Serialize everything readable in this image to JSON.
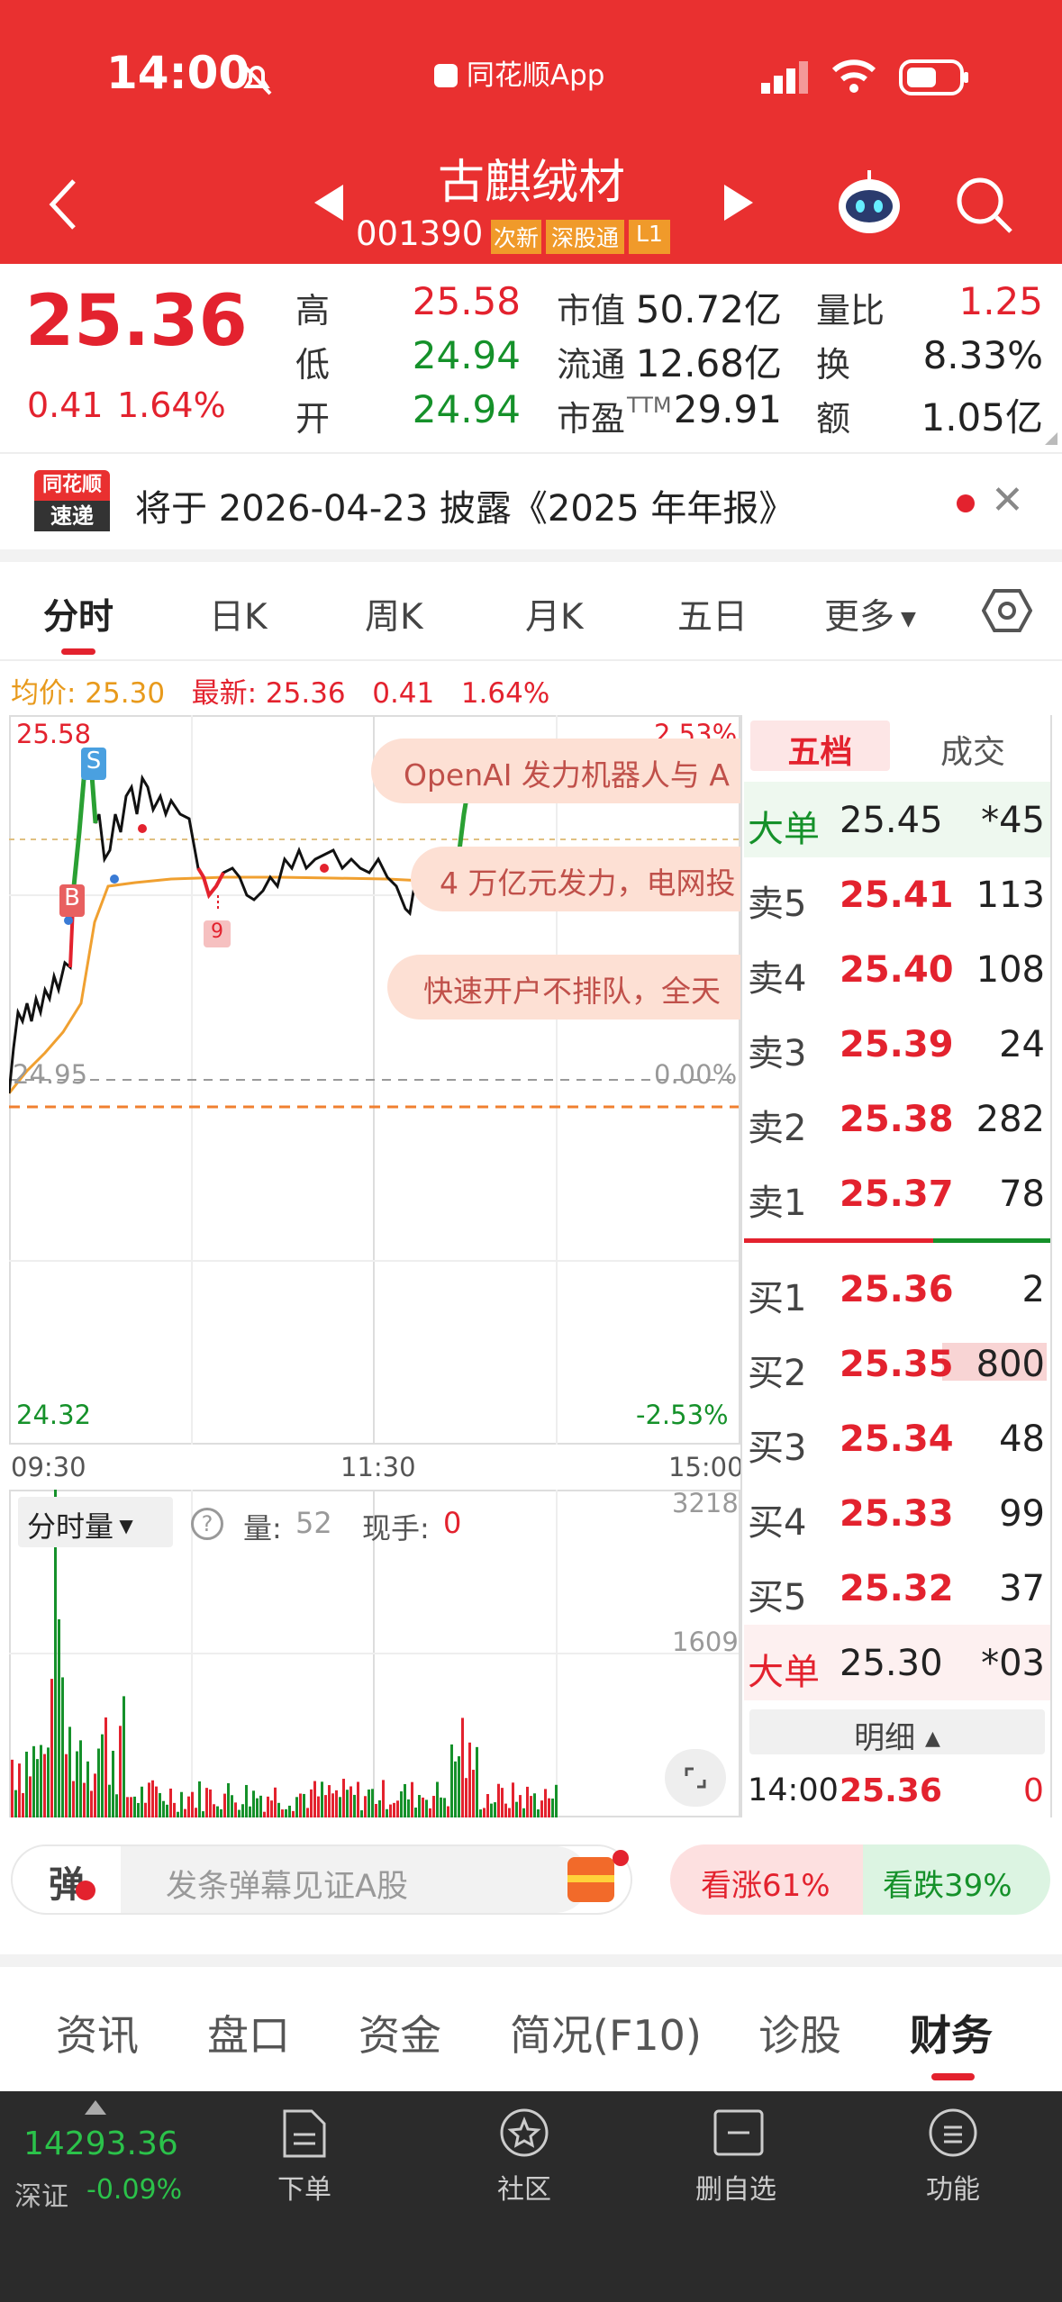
{
  "status": {
    "time": "14:00",
    "center": "同花顺App"
  },
  "header": {
    "name": "古麒绒材",
    "code": "001390",
    "tags": [
      "次新",
      "深股通",
      "L1"
    ]
  },
  "quote": {
    "price": "25.36",
    "change": "0.41",
    "pct": "1.64%",
    "high_l": "高",
    "high": "25.58",
    "low_l": "低",
    "low": "24.94",
    "open_l": "开",
    "open": "24.94",
    "mcap_l": "市值",
    "mcap": "50.72亿",
    "float_l": "流通",
    "float": "12.68亿",
    "pe_l": "市盈",
    "pe_sup": "TTM",
    "pe": "29.91",
    "vr_l": "量比",
    "vr": "1.25",
    "turn_l": "换",
    "turn": "8.33%",
    "amt_l": "额",
    "amt": "1.05亿"
  },
  "notice": {
    "logo1": "同花顺",
    "logo2": "速递",
    "text": "将于 2026-04-23 披露《2025 年年报》"
  },
  "tabs": [
    "分时",
    "日K",
    "周K",
    "月K",
    "五日",
    "更多"
  ],
  "chart_info": {
    "avg": "均价: 25.30",
    "latest": "最新: 25.36",
    "chg": "0.41",
    "pct": "1.64%"
  },
  "chart_labels": {
    "top": "25.58",
    "top_pct": "2.53%",
    "mid": "24.95",
    "mid_pct": "0.00%",
    "bot": "24.32",
    "bot_pct": "-2.53%",
    "t1": "09:30",
    "t2": "11:30",
    "t3": "15:00"
  },
  "markers": {
    "s": "S",
    "b": "B",
    "n9": "9"
  },
  "news": [
    "OpenAI 发力机器人与 A",
    "4 万亿元发力，电网投",
    "快速开户不排队，全天"
  ],
  "vol": {
    "selector": "分时量",
    "q": "量:",
    "qv": "52",
    "hand": "现手:",
    "hv": "0",
    "max": "3218",
    "mid": "1609"
  },
  "ob_tabs": [
    "五档",
    "成交"
  ],
  "orderbook": [
    {
      "l": "大单",
      "p": "25.45",
      "v": "*45"
    },
    {
      "l": "卖5",
      "p": "25.41",
      "v": "113"
    },
    {
      "l": "卖4",
      "p": "25.40",
      "v": "108"
    },
    {
      "l": "卖3",
      "p": "25.39",
      "v": "24"
    },
    {
      "l": "卖2",
      "p": "25.38",
      "v": "282"
    },
    {
      "l": "卖1",
      "p": "25.37",
      "v": "78"
    },
    {
      "l": "买1",
      "p": "25.36",
      "v": "2"
    },
    {
      "l": "买2",
      "p": "25.35",
      "v": "800"
    },
    {
      "l": "买3",
      "p": "25.34",
      "v": "48"
    },
    {
      "l": "买4",
      "p": "25.33",
      "v": "99"
    },
    {
      "l": "买5",
      "p": "25.32",
      "v": "37"
    },
    {
      "l": "大单",
      "p": "25.30",
      "v": "*03"
    }
  ],
  "detail": {
    "label": "明细",
    "time": "14:00",
    "price": "25.36",
    "vol": "0"
  },
  "danmu": {
    "icon": "弹",
    "placeholder": "发条弹幕见证A股",
    "up": "看涨61%",
    "down": "看跌39%"
  },
  "section_tabs": [
    "资讯",
    "盘口",
    "资金",
    "简况(F10)",
    "诊股",
    "财务"
  ],
  "bottom": {
    "index": "14293.36",
    "index_name": "深证",
    "index_pct": "-0.09%",
    "items": [
      "下单",
      "社区",
      "删自选",
      "功能"
    ]
  }
}
